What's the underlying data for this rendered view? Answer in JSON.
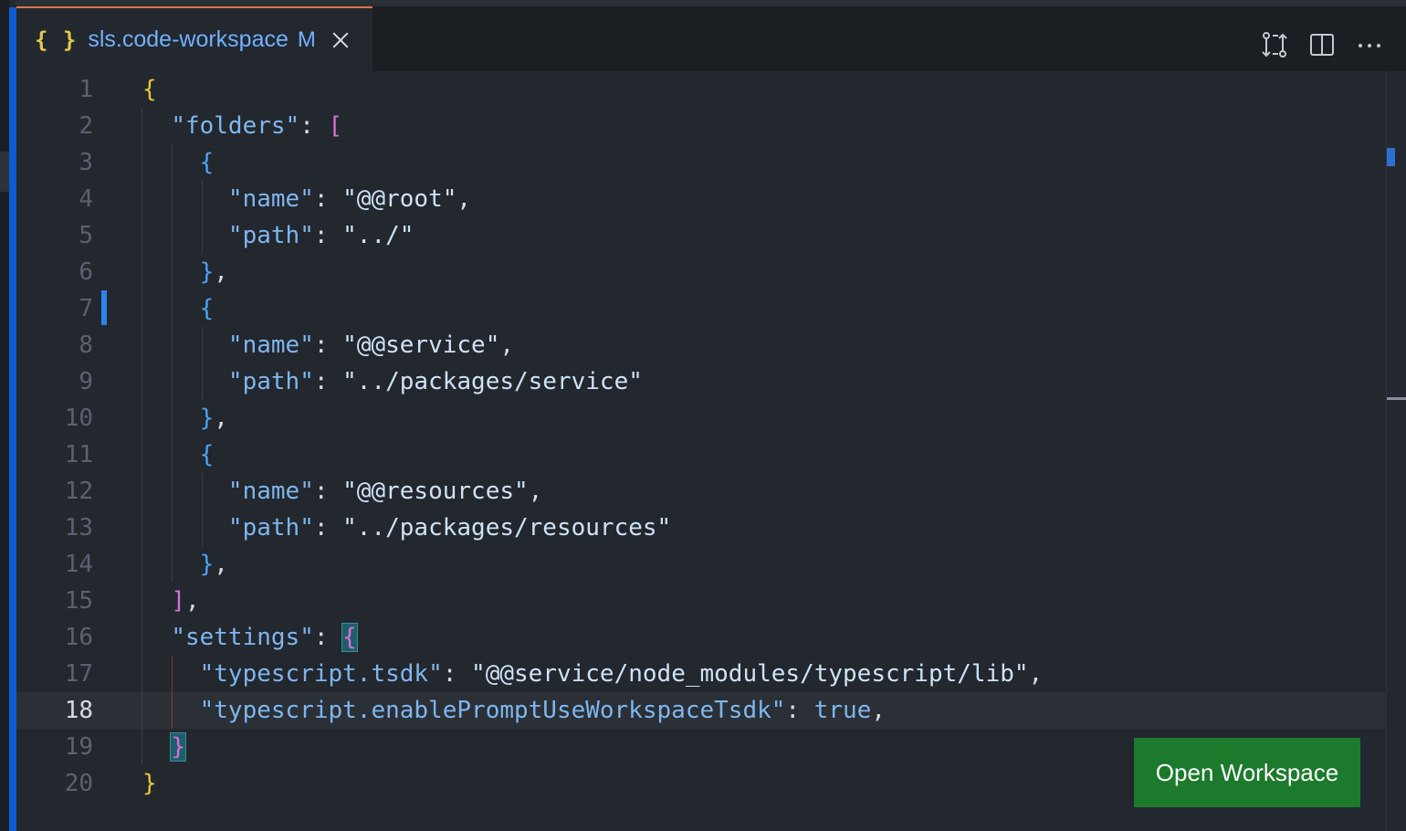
{
  "tab": {
    "icon": "{ }",
    "filename": "sls.code-workspace",
    "status": "M"
  },
  "toolbar": {
    "icons": [
      "compare-changes-icon",
      "split-editor-icon",
      "more-actions-icon"
    ],
    "more_label": "···"
  },
  "editor": {
    "current_line": 18,
    "line_numbers": [
      "1",
      "2",
      "3",
      "4",
      "5",
      "6",
      "7",
      "8",
      "9",
      "10",
      "11",
      "12",
      "13",
      "14",
      "15",
      "16",
      "17",
      "18",
      "19",
      "20"
    ],
    "lines": [
      [
        {
          "t": "{",
          "c": "b1"
        }
      ],
      [
        {
          "t": "  "
        },
        {
          "t": "\"folders\"",
          "c": "k"
        },
        {
          "t": ": ",
          "c": "p"
        },
        {
          "t": "[",
          "c": "b2"
        }
      ],
      [
        {
          "t": "    "
        },
        {
          "t": "{",
          "c": "b3"
        }
      ],
      [
        {
          "t": "      "
        },
        {
          "t": "\"name\"",
          "c": "k"
        },
        {
          "t": ": ",
          "c": "p"
        },
        {
          "t": "\"@@root\"",
          "c": "s"
        },
        {
          "t": ",",
          "c": "p"
        }
      ],
      [
        {
          "t": "      "
        },
        {
          "t": "\"path\"",
          "c": "k"
        },
        {
          "t": ": ",
          "c": "p"
        },
        {
          "t": "\"../\"",
          "c": "s"
        }
      ],
      [
        {
          "t": "    "
        },
        {
          "t": "}",
          "c": "b3"
        },
        {
          "t": ",",
          "c": "p"
        }
      ],
      [
        {
          "t": "    "
        },
        {
          "t": "{",
          "c": "b3"
        }
      ],
      [
        {
          "t": "      "
        },
        {
          "t": "\"name\"",
          "c": "k"
        },
        {
          "t": ": ",
          "c": "p"
        },
        {
          "t": "\"@@service\"",
          "c": "s"
        },
        {
          "t": ",",
          "c": "p"
        }
      ],
      [
        {
          "t": "      "
        },
        {
          "t": "\"path\"",
          "c": "k"
        },
        {
          "t": ": ",
          "c": "p"
        },
        {
          "t": "\"../packages/service\"",
          "c": "s"
        }
      ],
      [
        {
          "t": "    "
        },
        {
          "t": "}",
          "c": "b3"
        },
        {
          "t": ",",
          "c": "p"
        }
      ],
      [
        {
          "t": "    "
        },
        {
          "t": "{",
          "c": "b3"
        }
      ],
      [
        {
          "t": "      "
        },
        {
          "t": "\"name\"",
          "c": "k"
        },
        {
          "t": ": ",
          "c": "p"
        },
        {
          "t": "\"@@resources\"",
          "c": "s"
        },
        {
          "t": ",",
          "c": "p"
        }
      ],
      [
        {
          "t": "      "
        },
        {
          "t": "\"path\"",
          "c": "k"
        },
        {
          "t": ": ",
          "c": "p"
        },
        {
          "t": "\"../packages/resources\"",
          "c": "s"
        }
      ],
      [
        {
          "t": "    "
        },
        {
          "t": "}",
          "c": "b3"
        },
        {
          "t": ",",
          "c": "p"
        }
      ],
      [
        {
          "t": "  "
        },
        {
          "t": "]",
          "c": "b2"
        },
        {
          "t": ",",
          "c": "p"
        }
      ],
      [
        {
          "t": "  "
        },
        {
          "t": "\"settings\"",
          "c": "k"
        },
        {
          "t": ": ",
          "c": "p"
        },
        {
          "t": "{",
          "c": "b2 br-match"
        }
      ],
      [
        {
          "t": "    "
        },
        {
          "t": "\"typescript.tsdk\"",
          "c": "k"
        },
        {
          "t": ": ",
          "c": "p"
        },
        {
          "t": "\"@@service/node_modules/typescript/lib\"",
          "c": "s"
        },
        {
          "t": ",",
          "c": "p"
        }
      ],
      [
        {
          "t": "    "
        },
        {
          "t": "\"typescript.enablePromptUseWorkspaceTsdk\"",
          "c": "k"
        },
        {
          "t": ": ",
          "c": "p"
        },
        {
          "t": "true",
          "c": "bool"
        },
        {
          "t": ",",
          "c": "p"
        }
      ],
      [
        {
          "t": "  "
        },
        {
          "t": "}",
          "c": "b2 br-match"
        }
      ],
      [
        {
          "t": "}",
          "c": "b1"
        }
      ]
    ]
  },
  "open_workspace_button": "Open Workspace",
  "colors": {
    "accent": "#0b5bd5",
    "tab_border": "#d5784a",
    "button_bg": "#1c7a2c"
  }
}
